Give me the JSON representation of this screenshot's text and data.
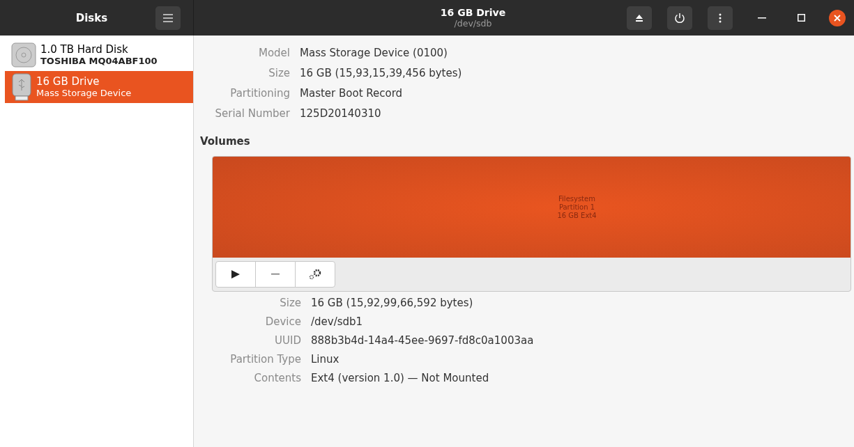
{
  "sidebar": {
    "title": "Disks",
    "disks": [
      {
        "kind": "hdd",
        "name": "1.0 TB Hard Disk",
        "subtitle": "TOSHIBA MQ04ABF100",
        "selected": false
      },
      {
        "kind": "usb",
        "name": "16 GB Drive",
        "subtitle": "Mass Storage Device",
        "selected": true
      }
    ]
  },
  "header": {
    "title": "16 GB Drive",
    "subtitle": "/dev/sdb"
  },
  "drive_info": [
    {
      "label": "Model",
      "value": "Mass Storage Device (0100)"
    },
    {
      "label": "Size",
      "value": "16 GB (15,93,15,39,456 bytes)"
    },
    {
      "label": "Partitioning",
      "value": "Master Boot Record"
    },
    {
      "label": "Serial Number",
      "value": "125D20140310"
    }
  ],
  "volumes": {
    "heading": "Volumes",
    "partition_lines": [
      "Filesystem",
      "Partition 1",
      "16 GB Ext4"
    ]
  },
  "volume_info": [
    {
      "label": "Size",
      "value": "16 GB (15,92,99,66,592 bytes)"
    },
    {
      "label": "Device",
      "value": "/dev/sdb1"
    },
    {
      "label": "UUID",
      "value": "888b3b4d-14a4-45ee-9697-fd8c0a1003aa"
    },
    {
      "label": "Partition Type",
      "value": "Linux"
    },
    {
      "label": "Contents",
      "value": "Ext4 (version 1.0) — Not Mounted"
    }
  ]
}
